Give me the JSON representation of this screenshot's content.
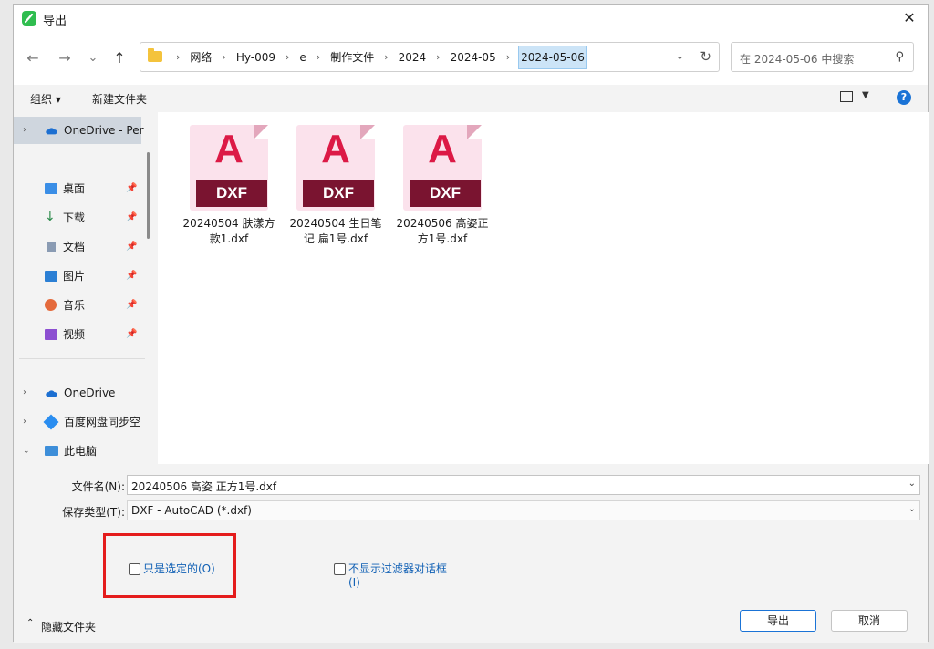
{
  "window": {
    "title": "导出",
    "close_glyph": "✕"
  },
  "nav": {
    "back_glyph": "←",
    "forward_glyph": "→",
    "recent_glyph": "⌄",
    "up_glyph": "↑",
    "breadcrumbs": [
      "网络",
      "Hy-009",
      "e",
      "制作文件",
      "2024",
      "2024-05",
      "2024-05-06"
    ],
    "refresh_glyph": "↻",
    "search_placeholder": "在 2024-05-06 中搜索"
  },
  "toolbar": {
    "organize": "组织 ▾",
    "new_folder": "新建文件夹",
    "help": "?"
  },
  "sidebar": {
    "items": [
      {
        "label": "OneDrive - Per",
        "icon": "cloud-icon"
      },
      {
        "label": "桌面",
        "icon": "desktop-icon"
      },
      {
        "label": "下载",
        "icon": "download-icon"
      },
      {
        "label": "文档",
        "icon": "document-icon"
      },
      {
        "label": "图片",
        "icon": "pictures-icon"
      },
      {
        "label": "音乐",
        "icon": "music-icon"
      },
      {
        "label": "视频",
        "icon": "video-icon"
      },
      {
        "label": "OneDrive",
        "icon": "cloud-icon"
      },
      {
        "label": "百度网盘同步空",
        "icon": "baidu-icon"
      },
      {
        "label": "此电脑",
        "icon": "computer-icon"
      }
    ]
  },
  "files": [
    {
      "name": "20240504 肤漾方款1.dxf",
      "type": "DXF",
      "letter": "A"
    },
    {
      "name": "20240504 生日笔记 扁1号.dxf",
      "type": "DXF",
      "letter": "A"
    },
    {
      "name": "20240506 高姿正方1号.dxf",
      "type": "DXF",
      "letter": "A"
    }
  ],
  "form": {
    "filename_label": "文件名(N):",
    "filename_value": "20240506 高姿 正方1号.dxf",
    "filetype_label": "保存类型(T):",
    "filetype_value": "DXF - AutoCAD (*.dxf)",
    "only_selected_label": "只是选定的(O)",
    "no_filter_label_line1": "不显示过滤器对话框",
    "no_filter_label_line2": "(I)",
    "hide_folders_label": "隐藏文件夹",
    "export_button": "导出",
    "cancel_button": "取消"
  },
  "colors": {
    "accent": "#1a73d6",
    "highlight_box": "#e41b1b",
    "dxf_band": "#7a1430",
    "dxf_letter": "#dc1a46"
  }
}
